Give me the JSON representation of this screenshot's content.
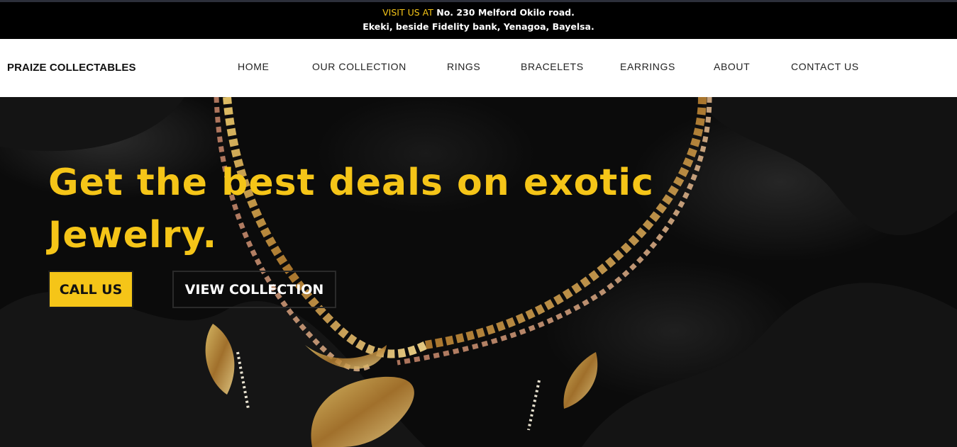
{
  "announcement": {
    "label": "VISIT US AT",
    "line1": "No. 230 Melford Okilo road.",
    "line2": "Ekeki, beside Fidelity bank, Yenagoa, Bayelsa."
  },
  "navbar": {
    "brand": "PRAIZE COLLECTABLES",
    "items": [
      {
        "label": "HOME"
      },
      {
        "label": "OUR COLLECTION"
      },
      {
        "label": "RINGS"
      },
      {
        "label": "BRACELETS"
      },
      {
        "label": "EARRINGS"
      },
      {
        "label": "ABOUT"
      },
      {
        "label": "CONTACT US"
      }
    ]
  },
  "hero": {
    "heading_line1": "Get the best deals on exotic",
    "heading_line2": "Jewelry.",
    "call_button": "CALL US",
    "view_button": "VIEW COLLECTION"
  },
  "colors": {
    "accent": "#f5c518",
    "background": "#000000",
    "nav_background": "#ffffff"
  }
}
